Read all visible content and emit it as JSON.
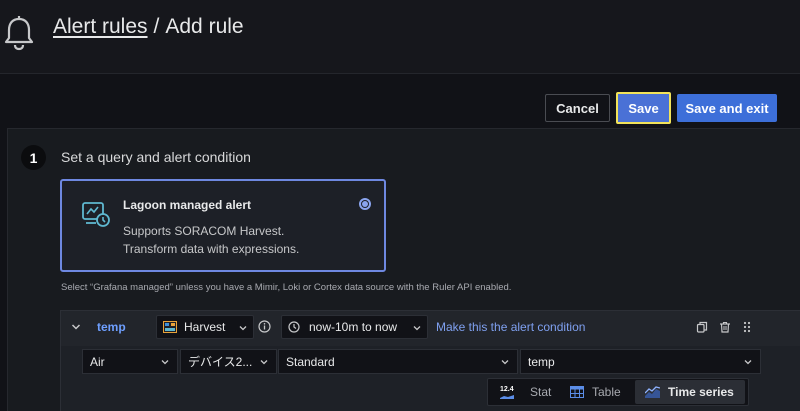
{
  "header": {
    "breadcrumb_link": "Alert rules",
    "breadcrumb_sep": "/",
    "breadcrumb_current": "Add rule",
    "icon": "bell-icon"
  },
  "toolbar": {
    "cancel_label": "Cancel",
    "save_label": "Save",
    "save_exit_label": "Save and exit"
  },
  "step": {
    "number": "1",
    "title": "Set a query and alert condition"
  },
  "alert_type_card": {
    "title": "Lagoon managed alert",
    "description_line1": "Supports SORACOM Harvest.",
    "description_line2": "Transform data with expressions.",
    "selected": true
  },
  "hint_text": "Select “Grafana managed” unless you have a Mimir, Loki or Cortex data source with the Ruler API enabled.",
  "query": {
    "name": "temp",
    "datasource": "Harvest",
    "time_range": "now-10m to now",
    "make_condition_label": "Make this the alert condition",
    "fields": [
      {
        "value": "Air"
      },
      {
        "value": "デバイス2..."
      },
      {
        "value": "Standard"
      },
      {
        "value": "temp"
      }
    ]
  },
  "visualization": {
    "options": [
      {
        "label": "Stat",
        "icon": "stat-icon",
        "glyph": "12.4",
        "active": false
      },
      {
        "label": "Table",
        "icon": "table-icon",
        "active": false
      },
      {
        "label": "Time series",
        "icon": "time-series-icon",
        "active": true
      }
    ]
  },
  "colors": {
    "accent": "#3d6fd9",
    "link": "#6e9fff",
    "focus_outline": "#f2e35a",
    "card_border": "#6e88e0"
  }
}
